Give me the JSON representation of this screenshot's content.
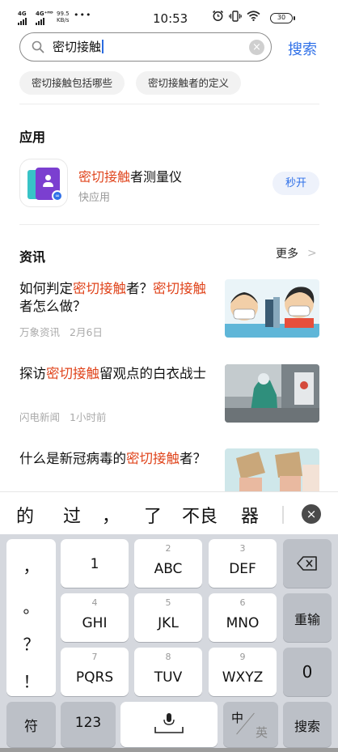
{
  "status_bar": {
    "net1": "4G",
    "net2": "4G⁺ᴴᴰ",
    "speed_value": "99.5",
    "speed_unit": "KB/s",
    "dots": "•••",
    "time": "10:53",
    "battery": "30"
  },
  "search": {
    "query": "密切接触",
    "submit_label": "搜索",
    "suggestions": [
      "密切接触包括哪些",
      "密切接触者的定义"
    ]
  },
  "apps_section": {
    "title": "应用",
    "app": {
      "name_highlight": "密切接触",
      "name_rest": "者测量仪",
      "subtitle": "快应用",
      "open_label": "秒开"
    }
  },
  "news_section": {
    "title": "资讯",
    "more_label": "更多",
    "items": [
      {
        "title_parts": [
          "如何判定",
          "密切接触",
          "者？",
          "密切接触",
          "者怎么做？"
        ],
        "source": "万象资讯",
        "time": "2月6日"
      },
      {
        "title_parts": [
          "探访",
          "密切接触",
          "留观点的白衣战士"
        ],
        "source": "闪电新闻",
        "time": "1小时前"
      },
      {
        "title_parts": [
          "什么是新冠病毒的",
          "密切接触",
          "者？"
        ],
        "source": "",
        "time": ""
      }
    ]
  },
  "ime": {
    "candidates": [
      "的",
      "过",
      "，",
      "了",
      "不良",
      "器"
    ],
    "punct_keys": [
      "，",
      "。",
      "？",
      "！"
    ],
    "keys": [
      {
        "num": "",
        "letters": "1"
      },
      {
        "num": "2",
        "letters": "ABC"
      },
      {
        "num": "3",
        "letters": "DEF"
      },
      {
        "num": "4",
        "letters": "GHI"
      },
      {
        "num": "5",
        "letters": "JKL"
      },
      {
        "num": "6",
        "letters": "MNO"
      },
      {
        "num": "7",
        "letters": "PQRS"
      },
      {
        "num": "8",
        "letters": "TUV"
      },
      {
        "num": "9",
        "letters": "WXYZ"
      }
    ],
    "reinput_label": "重输",
    "zero_label": "0",
    "symbol_label": "符",
    "numeric_label": "123",
    "lang_zh": "中",
    "lang_en": "英",
    "search_key_label": "搜索"
  }
}
